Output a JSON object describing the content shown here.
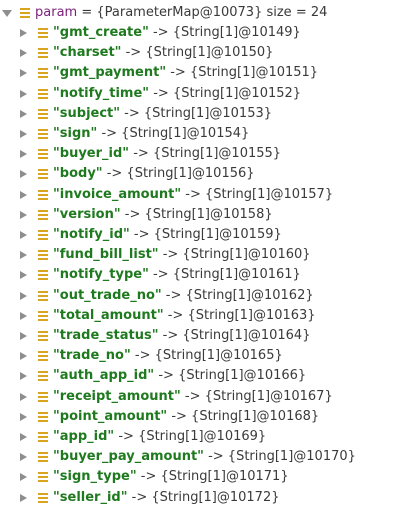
{
  "root": {
    "name": "param",
    "equals": " = ",
    "value": "{ParameterMap@10073}",
    "size": "  size = 24"
  },
  "separator": " -> ",
  "entries": [
    {
      "key": "\"gmt_create\"",
      "value": "{String[1]@10149}"
    },
    {
      "key": "\"charset\"",
      "value": "{String[1]@10150}"
    },
    {
      "key": "\"gmt_payment\"",
      "value": "{String[1]@10151}"
    },
    {
      "key": "\"notify_time\"",
      "value": "{String[1]@10152}"
    },
    {
      "key": "\"subject\"",
      "value": "{String[1]@10153}"
    },
    {
      "key": "\"sign\"",
      "value": "{String[1]@10154}"
    },
    {
      "key": "\"buyer_id\"",
      "value": "{String[1]@10155}"
    },
    {
      "key": "\"body\"",
      "value": "{String[1]@10156}"
    },
    {
      "key": "\"invoice_amount\"",
      "value": "{String[1]@10157}"
    },
    {
      "key": "\"version\"",
      "value": "{String[1]@10158}"
    },
    {
      "key": "\"notify_id\"",
      "value": "{String[1]@10159}"
    },
    {
      "key": "\"fund_bill_list\"",
      "value": "{String[1]@10160}"
    },
    {
      "key": "\"notify_type\"",
      "value": "{String[1]@10161}"
    },
    {
      "key": "\"out_trade_no\"",
      "value": "{String[1]@10162}"
    },
    {
      "key": "\"total_amount\"",
      "value": "{String[1]@10163}"
    },
    {
      "key": "\"trade_status\"",
      "value": "{String[1]@10164}"
    },
    {
      "key": "\"trade_no\"",
      "value": "{String[1]@10165}"
    },
    {
      "key": "\"auth_app_id\"",
      "value": "{String[1]@10166}"
    },
    {
      "key": "\"receipt_amount\"",
      "value": "{String[1]@10167}"
    },
    {
      "key": "\"point_amount\"",
      "value": "{String[1]@10168}"
    },
    {
      "key": "\"app_id\"",
      "value": "{String[1]@10169}"
    },
    {
      "key": "\"buyer_pay_amount\"",
      "value": "{String[1]@10170}"
    },
    {
      "key": "\"sign_type\"",
      "value": "{String[1]@10171}"
    },
    {
      "key": "\"seller_id\"",
      "value": "{String[1]@10172}"
    }
  ]
}
